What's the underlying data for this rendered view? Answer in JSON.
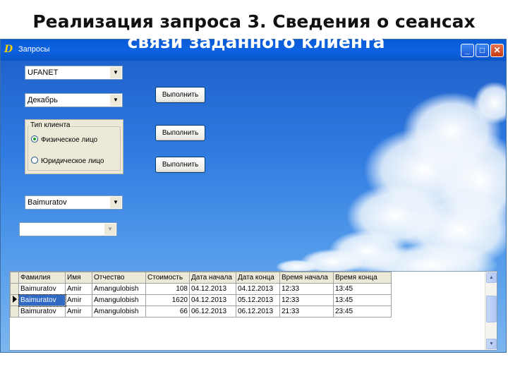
{
  "slide": {
    "title_line1": "Реализация запроса 3. Сведения о сеансах",
    "title_line2": "связи заданного клиента"
  },
  "window": {
    "title": "Запросы",
    "minimize_symbol": "_",
    "maximize_symbol": "□",
    "close_symbol": "✕"
  },
  "form": {
    "provider_combo": "UFANET",
    "month_combo": "Декабрь",
    "client_type_group": {
      "title": "Тип клиента",
      "options": [
        "Физическое лицо",
        "Юридическое лицо"
      ],
      "selected": "Физическое лицо"
    },
    "client_combo": "Baimuratov",
    "empty_combo": "",
    "execute_buttons": [
      "Выполнить",
      "Выполнить",
      "Выполнить"
    ]
  },
  "grid": {
    "columns": [
      "Фамилия",
      "Имя",
      "Отчество",
      "Стоимость",
      "Дата начала",
      "Дата конца",
      "Время начала",
      "Время конца"
    ],
    "rows": [
      [
        "Baimuratov",
        "Amir",
        "Amangulobish",
        "108",
        "04.12.2013",
        "04.12.2013",
        "12:33",
        "13:45"
      ],
      [
        "Baimuratov",
        "Amir",
        "Amangulobish",
        "1620",
        "04.12.2013",
        "05.12.2013",
        "12:33",
        "13:45"
      ],
      [
        "Baimuratov",
        "Amir",
        "Amangulobish",
        "66",
        "06.12.2013",
        "06.12.2013",
        "21:33",
        "23:45"
      ]
    ],
    "selected_row": 1
  },
  "colors": {
    "titlebar": "#0a5ad6",
    "sky_top": "#1c5dc8",
    "selection": "#316ac5"
  }
}
